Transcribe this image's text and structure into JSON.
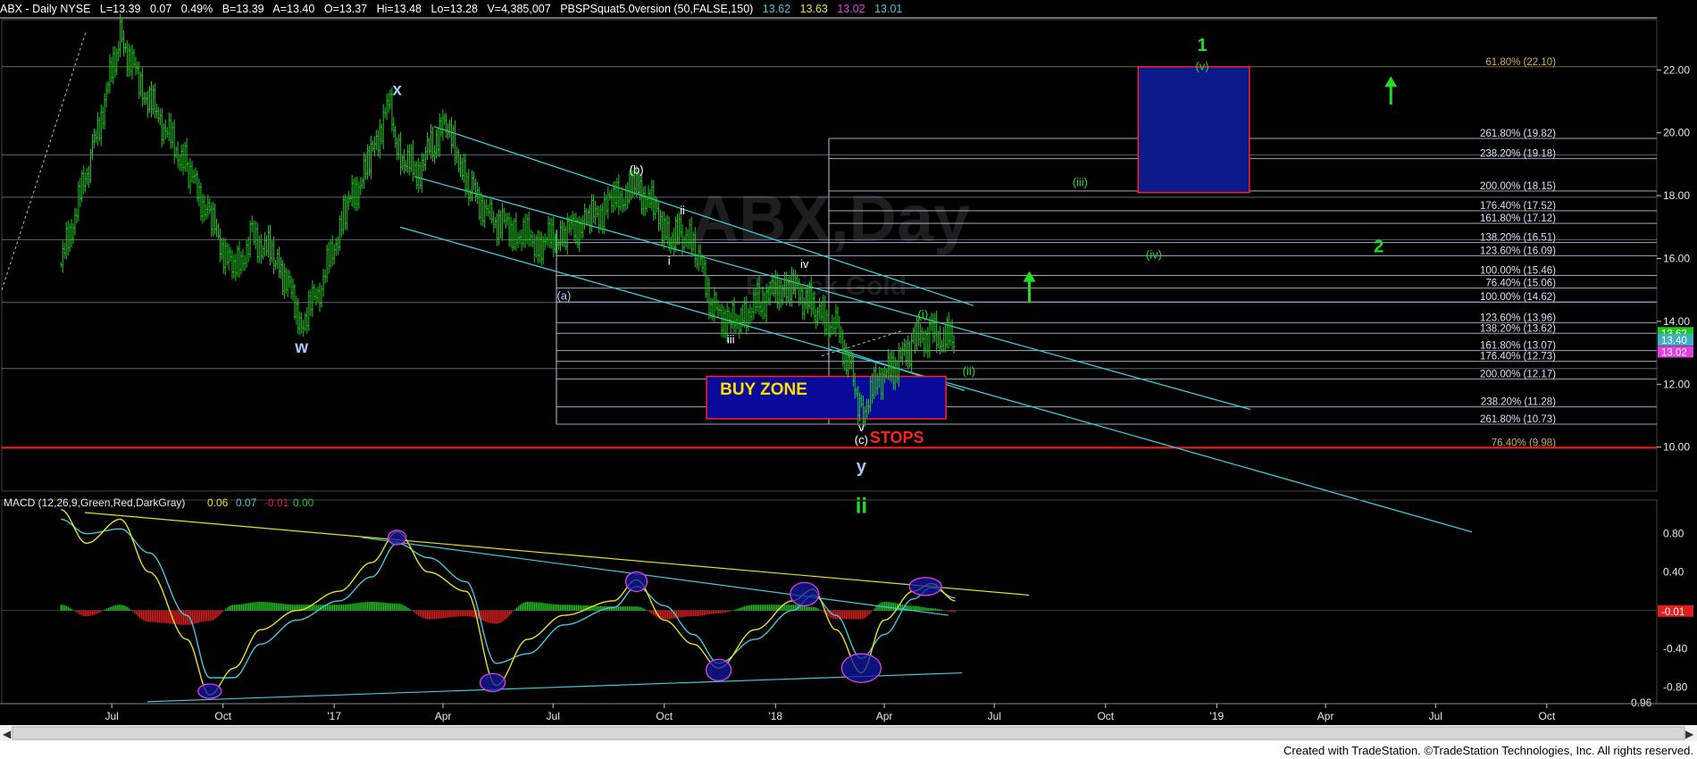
{
  "header": {
    "symbol": "ABX - Daily  NYSE",
    "last": "L=13.39",
    "change": "0.07",
    "change_pct": "0.49%",
    "bid": "B=13.39",
    "ask": "A=13.40",
    "open": "O=13.37",
    "high": "Hi=13.48",
    "low": "Lo=13.28",
    "volume": "V=4,385,007",
    "indicator": "PBSPSquat5.0version (50,FALSE,150)",
    "ind_values": [
      "13.62",
      "13.63",
      "13.02",
      "13.01"
    ]
  },
  "watermark": {
    "title": "ABX,Day",
    "subtitle": "Barrick Gold"
  },
  "footer": {
    "credit": "Created with TradeStation. ©TradeStation Technologies, Inc. All rights reserved."
  },
  "colors": {
    "background": "#000000",
    "price_bars": "#22c422",
    "channel": "#40c8d8",
    "fib_lines": "#b0c4de",
    "buy_zone_fill": "#0a0a9a",
    "buy_zone_border": "#ff2020",
    "target_box_fill": "#0a1a8a",
    "stops": "#ff2020",
    "macd_line": "#e8e020",
    "signal_line": "#40c8d8",
    "hist_pos": "#22c422",
    "hist_neg": "#e02020",
    "wave_green": "#22dd22",
    "wave_blue": "#a8c8ff",
    "fib_gold": "#c8b060"
  },
  "chart_data": [
    {
      "type": "line",
      "title": "ABX - Daily NYSE",
      "x_ticks": [
        "Jul",
        "Oct",
        "'17",
        "Apr",
        "Jul",
        "Oct",
        "'18",
        "Apr",
        "Jul",
        "Oct",
        "'19",
        "Apr",
        "Jul",
        "Oct"
      ],
      "y_ticks": [
        "10.00",
        "12.00",
        "14.00",
        "16.00",
        "18.00",
        "20.00",
        "22.00"
      ],
      "ylim": [
        8.6,
        23.6
      ],
      "series": [
        {
          "name": "ABX",
          "x": [
            "2016-05-20",
            "2016-06-15",
            "2016-07-08",
            "2016-07-25",
            "2016-08-10",
            "2016-09-01",
            "2016-09-20",
            "2016-10-10",
            "2016-10-25",
            "2016-11-15",
            "2016-12-05",
            "2016-12-20",
            "2017-01-10",
            "2017-01-30",
            "2017-02-15",
            "2017-02-22",
            "2017-03-10",
            "2017-03-25",
            "2017-04-05",
            "2017-04-14",
            "2017-04-25",
            "2017-05-10",
            "2017-05-30",
            "2017-06-20",
            "2017-07-10",
            "2017-07-30",
            "2017-08-20",
            "2017-09-08",
            "2017-09-25",
            "2017-10-05",
            "2017-10-16",
            "2017-10-28",
            "2017-11-10",
            "2017-11-25",
            "2017-12-05",
            "2017-12-20",
            "2018-01-10",
            "2018-01-25",
            "2018-02-05",
            "2018-02-20",
            "2018-03-05",
            "2018-03-13",
            "2018-03-28",
            "2018-04-10",
            "2018-04-25",
            "2018-05-10",
            "2018-05-30"
          ],
          "close": [
            15.8,
            19.4,
            23.1,
            21.5,
            20.4,
            18.9,
            17.3,
            15.5,
            16.7,
            16.0,
            14.0,
            15.0,
            17.5,
            19.0,
            21.0,
            19.5,
            18.7,
            19.8,
            20.3,
            18.8,
            18.2,
            17.3,
            16.9,
            16.5,
            16.8,
            17.2,
            17.8,
            18.3,
            17.5,
            16.7,
            16.8,
            16.2,
            14.4,
            14.0,
            14.2,
            14.7,
            15.2,
            14.8,
            14.2,
            13.9,
            12.4,
            11.1,
            12.2,
            12.5,
            13.4,
            13.6,
            13.4
          ]
        }
      ],
      "horizontal_levels": [
        {
          "label": "61.80% (22.10)",
          "value": 22.1
        },
        {
          "label": "261.80% (19.82)",
          "value": 19.82
        },
        {
          "label": "238.20% (19.18)",
          "value": 19.18
        },
        {
          "label": "200.00% (18.15)",
          "value": 18.15
        },
        {
          "label": "176.40% (17.52)",
          "value": 17.52
        },
        {
          "label": "161.80% (17.12)",
          "value": 17.12
        },
        {
          "label": "138.20% (16.51)",
          "value": 16.51
        },
        {
          "label": "123.60% (16.09)",
          "value": 16.09
        },
        {
          "label": "100.00% (15.46)",
          "value": 15.46
        },
        {
          "label": "76.40% (15.06)",
          "value": 15.06
        },
        {
          "label": "100.00% (14.62)",
          "value": 14.62
        },
        {
          "label": "123.60% (13.96)",
          "value": 13.96
        },
        {
          "label": "138.20% (13.62)",
          "value": 13.62
        },
        {
          "label": "161.80% (13.07)",
          "value": 13.07
        },
        {
          "label": "176.40% (12.73)",
          "value": 12.73
        },
        {
          "label": "200.00% (12.17)",
          "value": 12.17
        },
        {
          "label": "238.20% (11.28)",
          "value": 11.28
        },
        {
          "label": "261.80% (10.73)",
          "value": 10.73
        },
        {
          "label": "76.40% (9.98)",
          "value": 9.98
        }
      ],
      "price_labels": [
        {
          "text": "13.62",
          "value": 13.62,
          "bg": "#22c422"
        },
        {
          "text": "13.40",
          "value": 13.4,
          "bg": "#40b0c0"
        },
        {
          "text": "13.02",
          "value": 13.02,
          "bg": "#e040e0"
        }
      ],
      "wave_labels": [
        {
          "text": "x",
          "x": "2017-02-22",
          "y": 21.2,
          "color": "#a8c8ff",
          "size": 19
        },
        {
          "text": "w",
          "x": "2016-12-05",
          "y": 13.0,
          "color": "#a8c8ff",
          "size": 19
        },
        {
          "text": "(b)",
          "x": "2017-09-08",
          "y": 18.7,
          "color": "#ffffff",
          "size": 13
        },
        {
          "text": "(a)",
          "x": "2017-07-10",
          "y": 14.7,
          "color": "#a8c8ff",
          "size": 13
        },
        {
          "text": "ii",
          "x": "2017-10-16",
          "y": 17.4,
          "color": "#ffffff",
          "size": 13
        },
        {
          "text": "i",
          "x": "2017-10-05",
          "y": 15.8,
          "color": "#ffffff",
          "size": 13
        },
        {
          "text": "iii",
          "x": "2017-11-25",
          "y": 13.3,
          "color": "#ffffff",
          "size": 13
        },
        {
          "text": "iv",
          "x": "2018-01-25",
          "y": 15.7,
          "color": "#ffffff",
          "size": 13
        },
        {
          "text": "v",
          "x": "2018-03-13",
          "y": 10.5,
          "color": "#ffffff",
          "size": 13
        },
        {
          "text": "(c)",
          "x": "2018-03-13",
          "y": 10.1,
          "color": "#ffffff",
          "size": 13
        },
        {
          "text": "y",
          "x": "2018-03-13",
          "y": 9.2,
          "color": "#a8c8ff",
          "size": 20
        },
        {
          "text": "ii",
          "x": "2018-03-13",
          "y": 7.9,
          "color": "#22dd22",
          "size": 24
        },
        {
          "text": "(i)",
          "x": "2018-05-03",
          "y": 14.1,
          "color": "#22dd22",
          "size": 13
        },
        {
          "text": "(ii)",
          "x": "2018-06-10",
          "y": 12.3,
          "color": "#22dd22",
          "size": 13
        },
        {
          "text": "(iii)",
          "x": "2018-09-10",
          "y": 18.3,
          "color": "#22dd22",
          "size": 13
        },
        {
          "text": "(iv)",
          "x": "2018-11-10",
          "y": 16.0,
          "color": "#22dd22",
          "size": 13
        },
        {
          "text": "(v)",
          "x": "2018-12-20",
          "y": 22.0,
          "color": "#22dd22",
          "size": 13
        },
        {
          "text": "1",
          "x": "2018-12-20",
          "y": 22.6,
          "color": "#22dd22",
          "size": 20
        },
        {
          "text": "2",
          "x": "2019-05-15",
          "y": 16.2,
          "color": "#22dd22",
          "size": 20
        }
      ],
      "zones": {
        "buy_zone_label": "BUY ZONE",
        "stops_label": "STOPS"
      }
    },
    {
      "type": "line",
      "title": "MACD (12,26,9,Green,Red,DarkGray)",
      "values_shown": [
        "0.06",
        "0.07",
        "-0.01",
        "0.00"
      ],
      "y_ticks": [
        "0.80",
        "0.40",
        "0.00",
        "-0.40",
        "-0.80"
      ],
      "ylim": [
        -0.97,
        1.15
      ],
      "last_hist_label": "-0.01",
      "bottom_value": "-0.96",
      "series": [
        {
          "name": "MACD",
          "x": [
            "2016-05-20",
            "2016-06-10",
            "2016-07-08",
            "2016-08-01",
            "2016-09-01",
            "2016-09-20",
            "2016-10-10",
            "2016-11-01",
            "2016-12-01",
            "2017-01-05",
            "2017-02-01",
            "2017-02-22",
            "2017-03-20",
            "2017-04-20",
            "2017-05-15",
            "2017-06-10",
            "2017-07-10",
            "2017-08-20",
            "2017-09-08",
            "2017-10-01",
            "2017-10-25",
            "2017-11-15",
            "2017-12-15",
            "2018-01-15",
            "2018-02-01",
            "2018-02-20",
            "2018-03-13",
            "2018-04-01",
            "2018-04-25",
            "2018-05-10",
            "2018-05-30"
          ],
          "values": [
            1.05,
            0.7,
            0.95,
            0.4,
            -0.3,
            -0.88,
            -0.6,
            -0.2,
            0.0,
            0.2,
            0.5,
            0.82,
            0.4,
            0.2,
            -0.78,
            -0.3,
            -0.05,
            0.1,
            0.32,
            -0.1,
            -0.35,
            -0.6,
            -0.2,
            0.1,
            0.22,
            -0.2,
            -0.65,
            -0.1,
            0.2,
            0.28,
            0.1
          ]
        },
        {
          "name": "Signal",
          "x": [
            "2016-05-20",
            "2016-06-10",
            "2016-07-08",
            "2016-08-01",
            "2016-09-01",
            "2016-09-20",
            "2016-10-10",
            "2016-11-01",
            "2016-12-01",
            "2017-01-05",
            "2017-02-01",
            "2017-02-22",
            "2017-03-20",
            "2017-04-20",
            "2017-05-15",
            "2017-06-10",
            "2017-07-10",
            "2017-08-20",
            "2017-09-08",
            "2017-10-01",
            "2017-10-25",
            "2017-11-15",
            "2017-12-15",
            "2018-01-15",
            "2018-02-01",
            "2018-02-20",
            "2018-03-13",
            "2018-04-01",
            "2018-04-25",
            "2018-05-10",
            "2018-05-30"
          ],
          "values": [
            0.95,
            0.8,
            0.85,
            0.6,
            -0.05,
            -0.7,
            -0.7,
            -0.35,
            -0.1,
            0.1,
            0.35,
            0.7,
            0.55,
            0.3,
            -0.55,
            -0.45,
            -0.15,
            0.03,
            0.25,
            0.05,
            -0.25,
            -0.55,
            -0.3,
            0.0,
            0.16,
            -0.05,
            -0.5,
            -0.25,
            0.12,
            0.24,
            0.13
          ]
        }
      ]
    }
  ]
}
